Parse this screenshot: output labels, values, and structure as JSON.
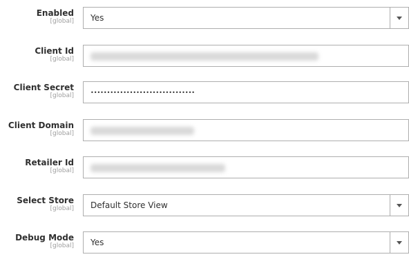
{
  "fields": [
    {
      "label": "Enabled",
      "scope": "[global]",
      "type": "select",
      "value": "Yes"
    },
    {
      "label": "Client Id",
      "scope": "[global]",
      "type": "input",
      "value": ""
    },
    {
      "label": "Client Secret",
      "scope": "[global]",
      "type": "password",
      "value": "••••••••••••••••••••••••••••••••"
    },
    {
      "label": "Client Domain",
      "scope": "[global]",
      "type": "input",
      "value": ""
    },
    {
      "label": "Retailer Id",
      "scope": "[global]",
      "type": "input",
      "value": ""
    },
    {
      "label": "Select Store",
      "scope": "[global]",
      "type": "select",
      "value": "Default Store View"
    },
    {
      "label": "Debug Mode",
      "scope": "[global]",
      "type": "select",
      "value": "Yes"
    }
  ],
  "icons": {
    "dropdown": "chevron-down-icon"
  }
}
